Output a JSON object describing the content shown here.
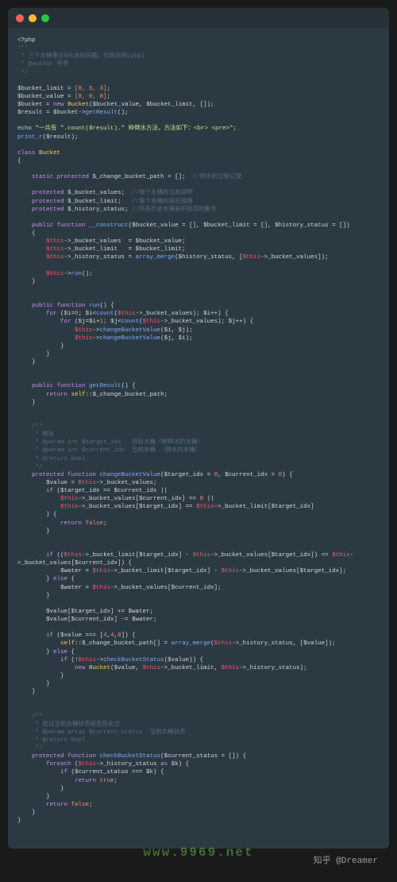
{
  "titlebar": {
    "dots": [
      "red",
      "yellow",
      "green"
    ]
  },
  "watermark_url": "www.9969.net",
  "watermark_author": "知乎 @Dreamer",
  "code": {
    "open_tag": "<?php",
    "header_comment": [
      "/**",
      " * 三个水桶等分8升水的问题，代码示例(php)",
      " * @author 许亮",
      " */"
    ],
    "init": [
      {
        "var": "$bucket_limit",
        "val": "[8, 5, 3]"
      },
      {
        "var": "$bucket_value",
        "val": "[8, 0, 0]"
      },
      {
        "var": "$bucket",
        "expr": "new Bucket($bucket_value, $bucket_limit, [])"
      },
      {
        "var": "$result",
        "expr": "$bucket->getResult()"
      }
    ],
    "echo_line": {
      "pre": "echo ",
      "str": "\"一共有 \".count($result).\" 种倒水方法，方法如下：<br> <pre>\";"
    },
    "print_line": "print_r($result);",
    "class_name": "Bucket",
    "static_prop": {
      "vis": "static protected",
      "name": "$_change_bucket_path",
      "init": "[]",
      "cmt": "//倒水的过程记录"
    },
    "props": [
      {
        "vis": "protected",
        "name": "$_bucket_values",
        "cmt": "//每个水桶的当前容积"
      },
      {
        "vis": "protected",
        "name": "$_bucket_limit",
        "cmt": "//每个水桶的容积规格"
      },
      {
        "vis": "protected",
        "name": "$_history_status",
        "cmt": "//所有历史水桶容积状态的集合"
      }
    ],
    "construct": {
      "sig": "__construct($bucket_value = [], $bucket_limit = [], $history_status = [])",
      "body": [
        "$this->_bucket_values  = $bucket_value;",
        "$this->_bucket_limit   = $bucket_limit;",
        "$this->_history_status = array_merge($history_status, [$this->_bucket_values]);",
        "",
        "$this->run();"
      ]
    },
    "run": {
      "sig": "run()",
      "for1": "for ($i=0; $i<count($this->_bucket_values); $i++) {",
      "for2": "for ($j=$i+1; $j<count($this->_bucket_values); $j++) {",
      "calls": [
        "$this->changeBucketValue($i, $j);",
        "$this->changeBucketValue($j, $i);"
      ]
    },
    "getResult": {
      "sig": "getResult()",
      "ret": "return self::$_change_bucket_path;"
    },
    "cbv_comment": [
      "/**",
      " * 倒水",
      " * @param int $target_idx   目标水桶（被倒水的水桶）",
      " * @param int $current_idx  当前水桶 （倒水的水桶）",
      " * @return bool",
      " */"
    ],
    "cbv": {
      "sig": "changeBucketValue($target_idx = 0, $current_idx = 0)",
      "l1": "$value = $this->_bucket_values;",
      "cond": [
        "if ($target_idx == $current_idx ||",
        "    $this->_bucket_values[$current_idx] == 0 ||",
        "    $this->_bucket_values[$target_idx] == $this->_bucket_limit[$target_idx]",
        ") {",
        "    return false;",
        "}"
      ],
      "if2": "if (($this->_bucket_limit[$target_idx] - $this->_bucket_values[$target_idx]) <= $this->",
      "if2b": "_bucket_values[$current_idx]) {",
      "w1": "$water = $this->_bucket_limit[$target_idx] - $this->_bucket_values[$target_idx];",
      "else": "} else {",
      "w2": "$water = $this->_bucket_values[$current_idx];",
      "close": "}",
      "assigns": [
        "$value[$target_idx] += $water;",
        "$value[$current_idx] -= $water;"
      ],
      "if3": "if ($value === [4,4,0]) {",
      "merge": "self::$_change_bucket_path[] = array_merge($this->_history_status, [$value]);",
      "else2": "} else {",
      "if4": "if (!$this->checkBucketStatus($value)) {",
      "new": "new Bucket($value, $this->_bucket_limit, $this->_history_status);"
    },
    "cbs_comment": [
      "/**",
      " * 验证当前水桶状态是否存在过",
      " * @param array $current_status  当前水桶状态",
      " * @return bool",
      " */"
    ],
    "cbs": {
      "sig": "checkBucketStatus($current_status = [])",
      "foreach": "foreach ($this->_history_status as $k) {",
      "if": "if ($current_status === $k) {",
      "ret_t": "return true;",
      "ret_f": "return false;"
    }
  }
}
